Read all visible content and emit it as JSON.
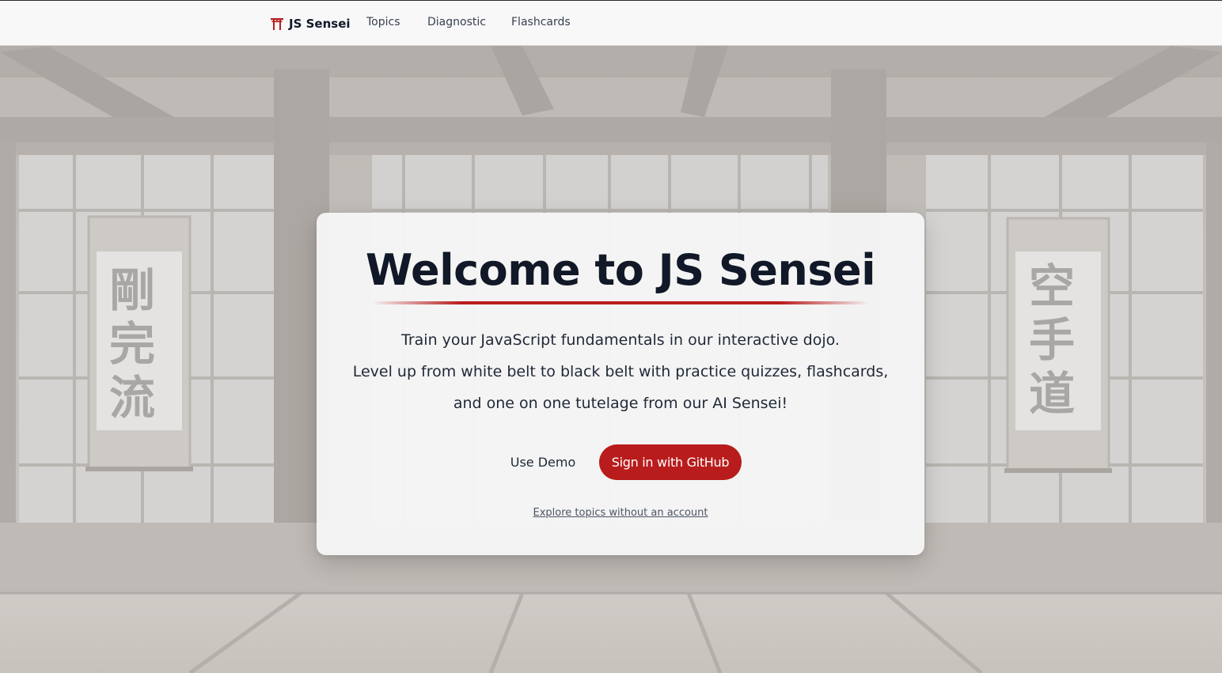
{
  "nav": {
    "brand": "JS Sensei",
    "brand_icon": "torii-gate-icon",
    "links": [
      "Topics",
      "Diagnostic",
      "Flashcards"
    ]
  },
  "background": {
    "left_scroll_text": "剛完流",
    "right_scroll_text": "空手道"
  },
  "hero": {
    "title": "Welcome to JS Sensei",
    "line1": "Train your JavaScript fundamentals in our interactive dojo.",
    "line2": "Level up from white belt to black belt with practice quizzes, flashcards,",
    "line3": "and one on one tutelage from our AI Sensei!",
    "demo_label": "Use Demo",
    "github_label": "Sign in with GitHub",
    "explore_label": "Explore topics without an account"
  },
  "colors": {
    "accent": "#b91c1c",
    "title": "#111827",
    "nav_bg": "#f8f8f8"
  }
}
